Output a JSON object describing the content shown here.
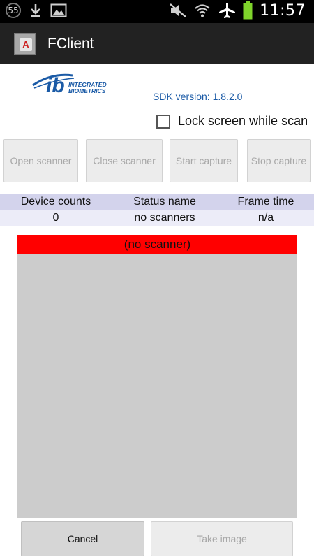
{
  "status_bar": {
    "notification_count": "55",
    "time": "11:57",
    "icons": [
      "notification-badge-icon",
      "download-icon",
      "image-icon",
      "mute-icon",
      "wifi-icon",
      "airplane-icon",
      "battery-icon"
    ]
  },
  "action_bar": {
    "title": "FClient",
    "app_icon_glyph": "A"
  },
  "header": {
    "logo_text_line1": "INTEGRATED",
    "logo_text_line2": "BIOMETRICS",
    "logo_mark": "ib",
    "sdk_version": "SDK version: 1.8.2.0"
  },
  "lock_screen": {
    "label": "Lock screen while scan",
    "checked": false
  },
  "buttons": {
    "open_scanner": "Open scanner",
    "close_scanner": "Close scanner",
    "start_capture": "Start capture",
    "stop_capture": "Stop capture",
    "cancel": "Cancel",
    "take_image": "Take image"
  },
  "status_table": {
    "headers": [
      "Device counts",
      "Status name",
      "Frame time"
    ],
    "row": [
      "0",
      "no scanners",
      "n/a"
    ]
  },
  "scanner_view": {
    "banner": "(no scanner)",
    "banner_color": "#ff0000",
    "image_bg_color": "#cccccc"
  },
  "colors": {
    "action_bar_bg": "#222222",
    "sdk_text": "#1a5aa6",
    "table_header_bg": "#d3d3ec",
    "table_row_bg": "#ececf8"
  }
}
